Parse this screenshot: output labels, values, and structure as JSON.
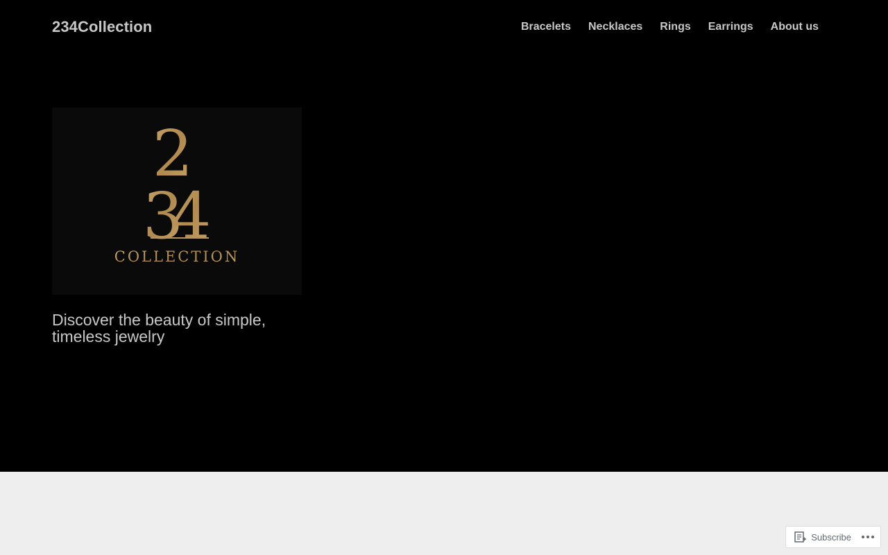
{
  "header": {
    "site_title": "234Collection",
    "nav": [
      "Bracelets",
      "Necklaces",
      "Rings",
      "Earrings",
      "About us"
    ]
  },
  "hero": {
    "logo": {
      "numerals": "234",
      "wordmark": "COLLECTION",
      "color": "#b8935a"
    },
    "tagline": "Discover the beauty of simple, timeless jewelry"
  },
  "footer_actions": {
    "subscribe_label": "Subscribe",
    "subscribe_icon": "reader-icon",
    "more_icon": "ellipsis-icon"
  },
  "colors": {
    "hero_background": "#000000",
    "page_background": "#eeeeee",
    "text": "#c8c8c8",
    "gold": "#b8935a"
  }
}
